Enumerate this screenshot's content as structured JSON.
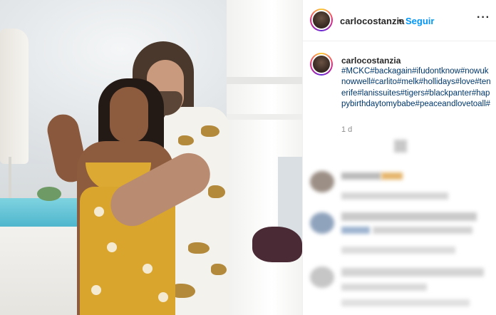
{
  "post": {
    "username": "carlocostanzia",
    "separator": "•",
    "follow_label": "Seguir",
    "more_label": "···",
    "caption": {
      "username": "carlocostanzia",
      "hashtags": "#MCKC#backagain#ifudontknow#nowuknowwell#carlito#melk#hollidays#love#tenerife#lanissuites#tigers#blackpanter#happybirthdaytomybabe#peaceandlovetoall#"
    },
    "timestamp": "1 d"
  },
  "colors": {
    "link_blue": "#0095f6",
    "hashtag_blue": "#00376b",
    "muted": "#8e8e8e"
  },
  "icons": {
    "more": "more-options-icon",
    "avatar": "profile-avatar"
  }
}
